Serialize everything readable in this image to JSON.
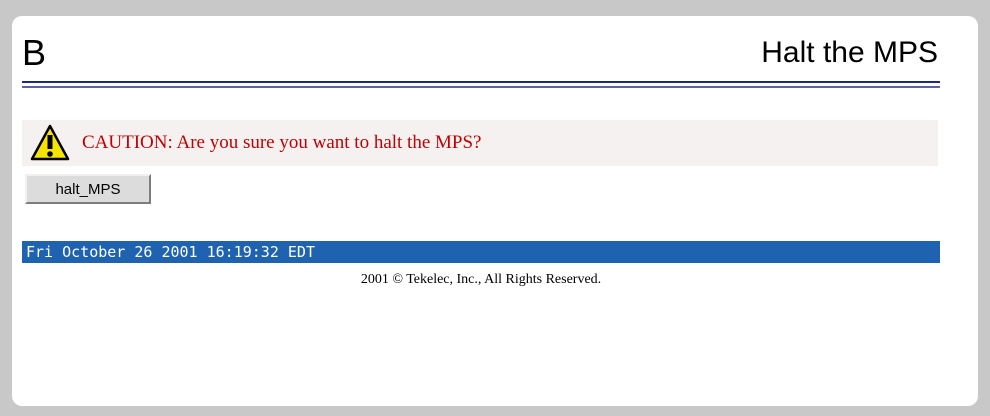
{
  "header": {
    "letter": "B",
    "title": "Halt the MPS"
  },
  "caution": {
    "icon": "warning-icon",
    "text": "CAUTION: Are you sure you want to halt the MPS?",
    "color": "#c20000"
  },
  "halt_button": {
    "label": "halt_MPS"
  },
  "status_bar": {
    "datetime": "Fri October 26 2001 16:19:32 EDT",
    "color": "#1f63b0"
  },
  "footer": {
    "copyright": "2001 © Tekelec, Inc., All Rights Reserved."
  }
}
